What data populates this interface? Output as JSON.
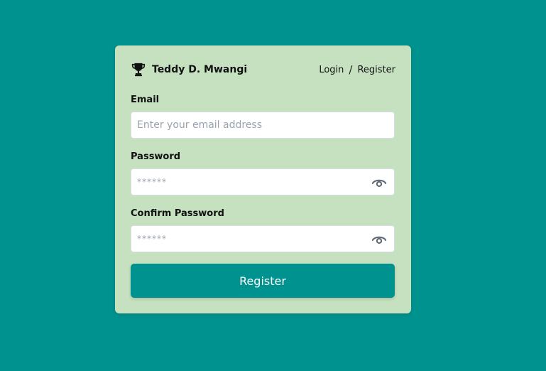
{
  "brand": {
    "name": "Teddy D. Mwangi",
    "icon": "trophy-icon"
  },
  "nav": {
    "login": "Login",
    "separator": "/",
    "register": "Register"
  },
  "form": {
    "email": {
      "label": "Email",
      "placeholder": "Enter your email address",
      "value": ""
    },
    "password": {
      "label": "Password",
      "placeholder": "******",
      "value": "",
      "toggle_icon": "eye-icon"
    },
    "confirm_password": {
      "label": "Confirm Password",
      "placeholder": "******",
      "value": "",
      "toggle_icon": "eye-icon"
    },
    "submit_label": "Register"
  },
  "colors": {
    "background": "#00928f",
    "card": "#c5e1bf",
    "button": "#00928f",
    "button_text": "#ffffff"
  }
}
